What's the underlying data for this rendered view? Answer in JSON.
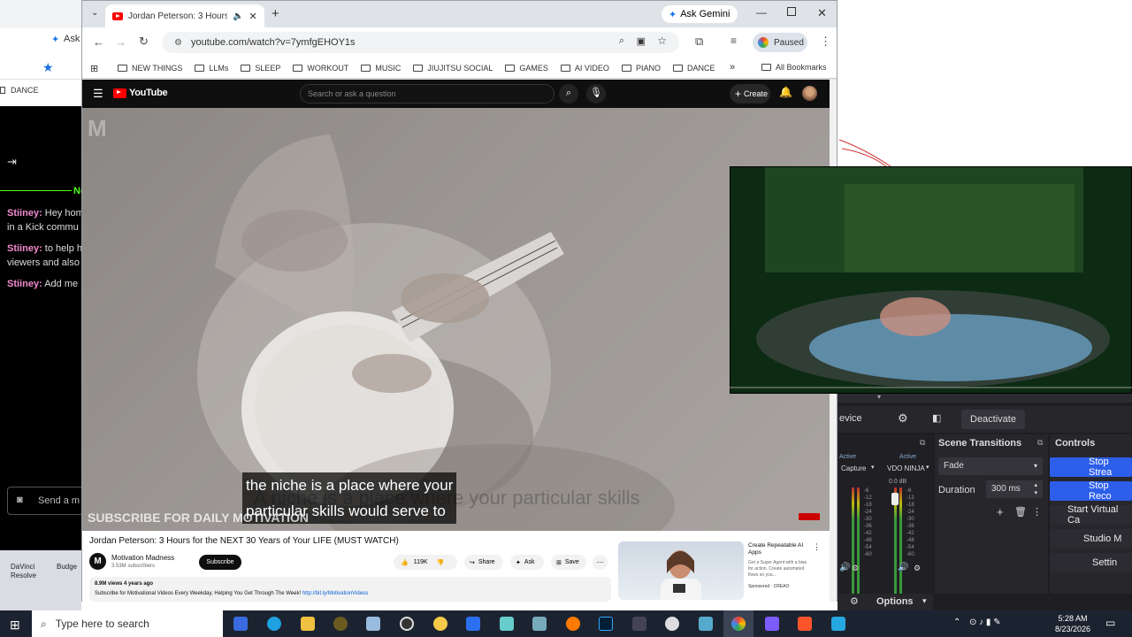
{
  "bgwin": {
    "tab_label": "Ask",
    "bookmark": "DANCE",
    "chat_partial": "Ne",
    "chat": [
      {
        "user": "Stiiney:",
        "text": "Hey hom"
      },
      {
        "user": "",
        "text": "in a Kick commu"
      },
      {
        "user": "Stiiney:",
        "text": "to help h"
      },
      {
        "user": "",
        "text": "viewers and also"
      },
      {
        "user": "Stiiney:",
        "text": "Add me"
      }
    ],
    "send_placeholder": "Send a m",
    "desktop_icons": [
      "DaVinci Resolve",
      "Budge"
    ]
  },
  "chrome": {
    "tab_title": "Jordan Peterson: 3 Hours fo",
    "ask_gemini": "Ask Gemini",
    "url": "youtube.com/watch?v=7ymfgEHOY1s",
    "profile_status": "Paused",
    "bookmarks": [
      "NEW THINGS",
      "LLMs",
      "SLEEP",
      "WORKOUT",
      "MUSIC",
      "JIUJITSU SOCIAL",
      "GAMES",
      "AI VIDEO",
      "PIANO",
      "DANCE"
    ],
    "all_bookmarks": "All Bookmarks"
  },
  "youtube": {
    "logo": "YouTube",
    "search_placeholder": "Search or ask a question",
    "create": "Create",
    "caption_line1": "the niche is a place where your",
    "caption_line2": "particular skills would serve to",
    "ghost_caption": "A niche is a place where your particular skills",
    "watermark": "SUBSCRIBE FOR DAILY MOTIVATION",
    "video_title": "Jordan Peterson: 3 Hours for the NEXT 30 Years of Your LIFE (MUST WATCH)",
    "channel": "Motivation Madness",
    "subscribers": "3.53M subscribers",
    "subscribe": "Subscribe",
    "likes": "119K",
    "share": "Share",
    "ask": "Ask",
    "save": "Save",
    "views": "8.9M views  4 years ago",
    "description": "Subscribe for Motivational Videos Every Weekday, Helping You Get Through The Week!",
    "desc_link": "http://bit.ly/MotivationVideos",
    "ad_title": "Create Repeatable AI Apps",
    "ad_text": "Get a Super Agent with a bias for action. Create automated flows so you...",
    "ad_sponsored": "Sponsored · CREAO"
  },
  "obs": {
    "device": "evice",
    "deactivate": "Deactivate",
    "scene_transitions": "Scene Transitions",
    "controls": "Controls",
    "active1": "Active",
    "active2": "Active",
    "capture": "Capture",
    "vdo_ninja": "VDO NINJA",
    "db": "0.0 dB",
    "meter_labels": [
      "-6",
      "-12",
      "-18",
      "-24",
      "-30",
      "-36",
      "-42",
      "-48",
      "-54",
      "-60"
    ],
    "fade": "Fade",
    "duration_label": "Duration",
    "duration_value": "300 ms",
    "options": "Options",
    "ctrl_buttons": [
      "Stop Strea",
      "Stop Reco",
      "Start Virtual Ca",
      "Studio M",
      "Settin"
    ]
  },
  "taskbar": {
    "search": "Type here to search",
    "time": "5:28 AM",
    "date": "8/23/2026"
  }
}
